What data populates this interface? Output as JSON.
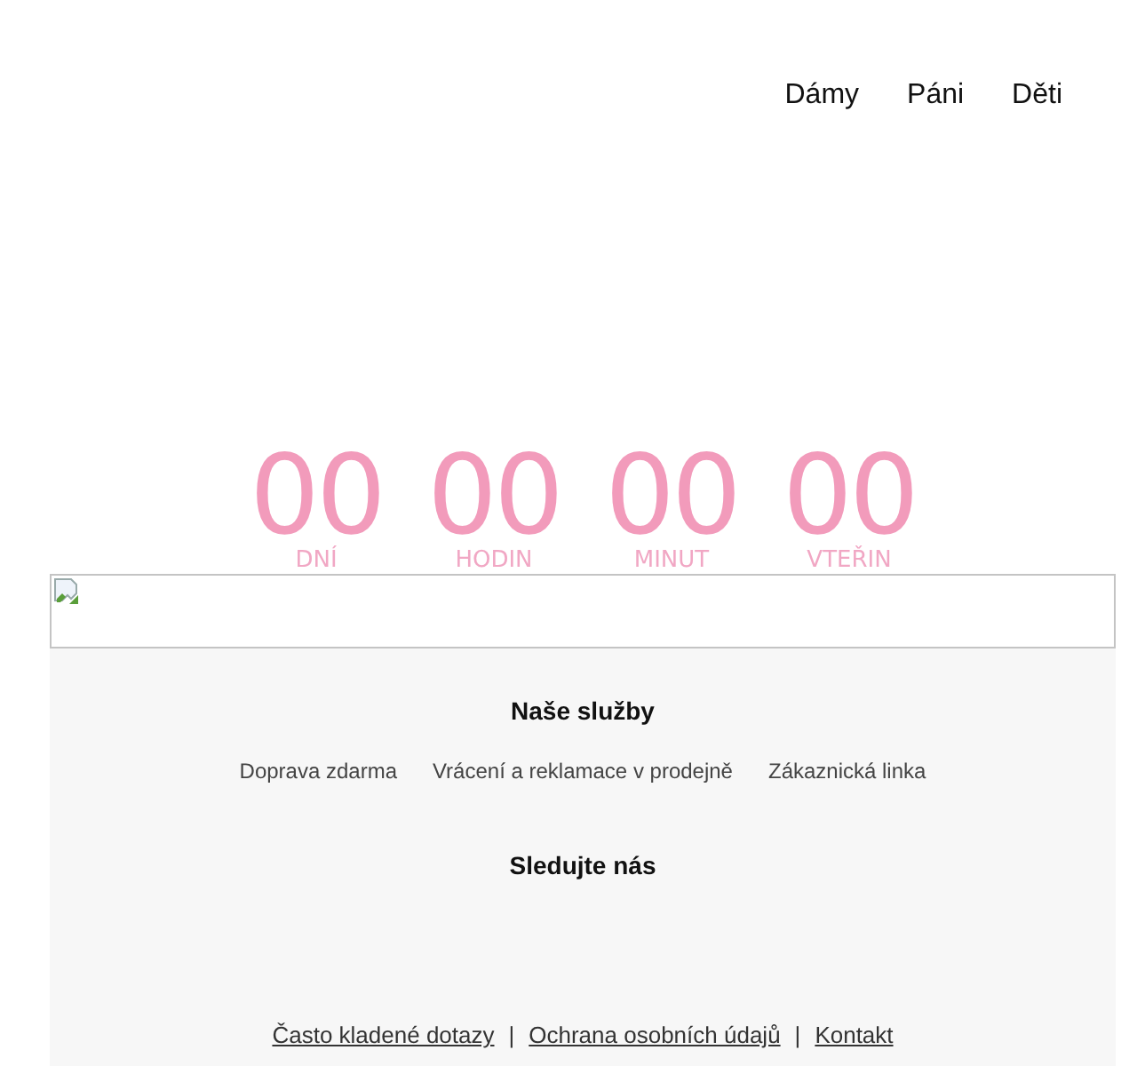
{
  "nav": {
    "items": [
      {
        "label": "Dámy"
      },
      {
        "label": "Páni"
      },
      {
        "label": "Děti"
      }
    ]
  },
  "countdown": {
    "units": [
      {
        "value": "00",
        "label": "DNÍ"
      },
      {
        "value": "00",
        "label": "HODIN"
      },
      {
        "value": "00",
        "label": "MINUT"
      },
      {
        "value": "00",
        "label": "VTEŘIN"
      }
    ]
  },
  "banner": {
    "kind": "broken-image"
  },
  "footer": {
    "services_title": "Naše služby",
    "services": [
      "Doprava zdarma",
      "Vrácení a reklamace v prodejně",
      "Zákaznická linka"
    ],
    "follow_title": "Sledujte nás",
    "links": [
      "Často kladené dotazy",
      "Ochrana osobních údajů",
      "Kontakt"
    ],
    "separator": "|"
  }
}
